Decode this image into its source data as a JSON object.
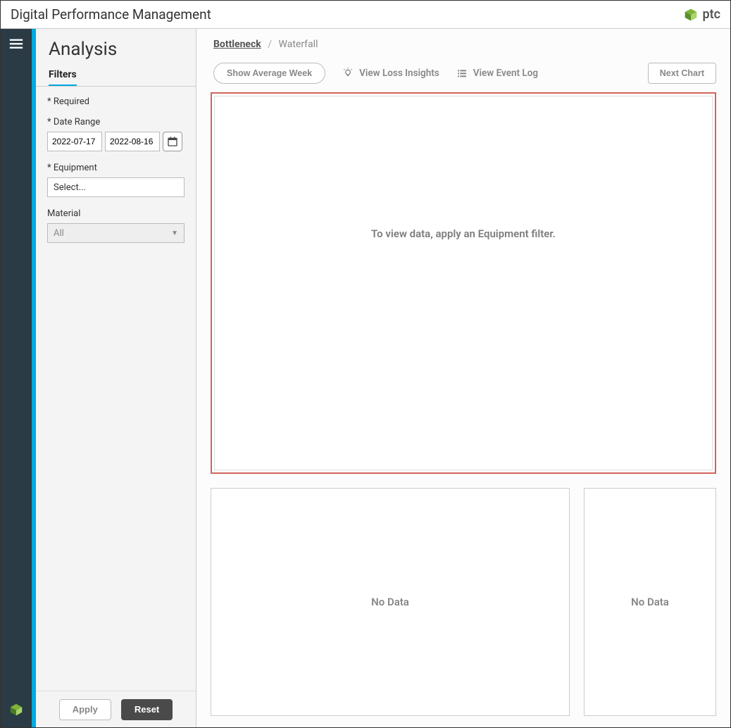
{
  "header": {
    "title": "Digital Performance Management",
    "brand": "ptc"
  },
  "sidebar": {
    "title": "Analysis",
    "tab": "Filters",
    "required_note": "* Required",
    "date_range_label": "* Date Range",
    "date_start": "2022-07-17",
    "date_end": "2022-08-16",
    "equipment_label": "* Equipment",
    "equipment_placeholder": "Select...",
    "material_label": "Material",
    "material_value": "All",
    "apply_label": "Apply",
    "reset_label": "Reset"
  },
  "breadcrumb": {
    "active": "Bottleneck",
    "next": "Waterfall"
  },
  "toolbar": {
    "avg_week": "Show Average Week",
    "loss_insights": "View Loss Insights",
    "event_log": "View Event Log",
    "next_chart": "Next Chart"
  },
  "main": {
    "empty_msg": "To view data, apply an Equipment filter.",
    "no_data": "No Data"
  }
}
